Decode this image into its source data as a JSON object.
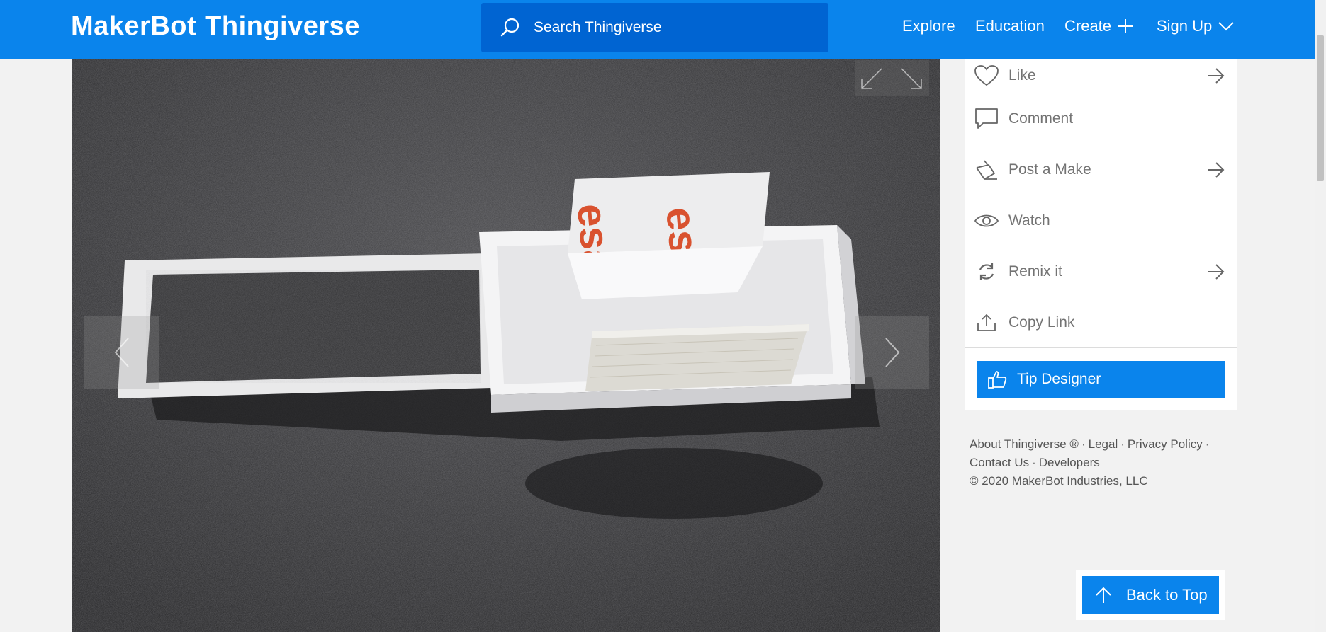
{
  "header": {
    "logo_maker": "MakerBot",
    "logo_thingiverse": "Thingiverse",
    "search_placeholder": "Search Thingiverse",
    "nav": {
      "explore": "Explore",
      "education": "Education",
      "create": "Create",
      "signup": "Sign Up"
    }
  },
  "actions": [
    {
      "label": "Like",
      "icon": "heart-icon",
      "arrow": true
    },
    {
      "label": "Comment",
      "icon": "comment-icon",
      "arrow": false
    },
    {
      "label": "Post a Make",
      "icon": "make-icon",
      "arrow": true
    },
    {
      "label": "Watch",
      "icon": "eye-icon",
      "arrow": false
    },
    {
      "label": "Remix it",
      "icon": "remix-icon",
      "arrow": true
    },
    {
      "label": "Copy Link",
      "icon": "upload-icon",
      "arrow": false
    }
  ],
  "tip_button": "Tip Designer",
  "footer": {
    "about": "About Thingiverse ®",
    "legal": "Legal",
    "privacy": "Privacy Policy",
    "contact": "Contact Us",
    "developers": "Developers",
    "copyright": "©  2020 MakerBot Industries, LLC"
  },
  "back_to_top": "Back to Top",
  "colors": {
    "brand_blue": "#0a84ec",
    "search_blue": "#0064d2"
  }
}
